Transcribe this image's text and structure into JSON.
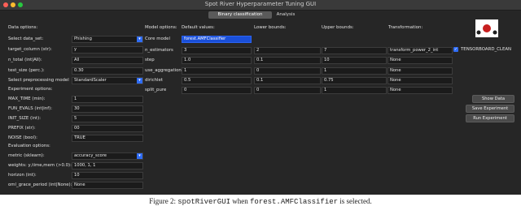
{
  "window": {
    "title": "Spot River Hyperparameter Tuning GUI"
  },
  "tabs": [
    {
      "label": "Binary classification"
    },
    {
      "label": "Analysis"
    }
  ],
  "data": {
    "header": "Data options:",
    "select_data_set_label": "Select data_set:",
    "data_set_value": "Phishing",
    "target_column_label": "target_column (str):",
    "target_column_value": "y",
    "n_total_label": "n_total (int|All):",
    "n_total_value": "All",
    "test_size_label": "test_size (perc.):",
    "test_size_value": "0.30",
    "prep_model_label": "Select preprocessing model",
    "prep_model_value": "StandardScaler"
  },
  "experiment": {
    "header": "Experiment options:",
    "max_time_label": "MAX_TIME (min):",
    "max_time_value": "1",
    "fun_evals_label": "FUN_EVALS (int|inf):",
    "fun_evals_value": "30",
    "init_size_label": "INIT_SIZE (int):",
    "init_size_value": "5",
    "prefix_label": "PREFIX (str):",
    "prefix_value": "00",
    "noise_label": "NOISE (bool):",
    "noise_value": "TRUE"
  },
  "evaluation": {
    "header": "Evaluation options:",
    "metric_label": "metric (sklearn):",
    "metric_value": "accuracy_score",
    "weights_label": "weights: y,time,mem (>0.0):",
    "weights_value": "1000, 1, 1",
    "horizon_label": "horizon (int):",
    "horizon_value": "10",
    "oml_label": "oml_grace_period (int|None):",
    "oml_value": "None"
  },
  "model": {
    "header": "Model options:",
    "core_model_label": "Core model",
    "core_model_value": "forest.AMFClassifier",
    "col_default": "Default values:",
    "col_lower": "Lower bounds:",
    "col_upper": "Upper bounds:",
    "col_transform": "Transformation:",
    "rows": [
      {
        "name": "n_estimators",
        "default": "3",
        "lower": "2",
        "upper": "7",
        "transform": "transform_power_2_int"
      },
      {
        "name": "step",
        "default": "1.0",
        "lower": "0.1",
        "upper": "10",
        "transform": "None"
      },
      {
        "name": "use_aggregation",
        "default": "1",
        "lower": "0",
        "upper": "1",
        "transform": "None"
      },
      {
        "name": "dirichlet",
        "default": "0.5",
        "lower": "0.1",
        "upper": "0.75",
        "transform": "None"
      },
      {
        "name": "split_pure",
        "default": "0",
        "lower": "0",
        "upper": "1",
        "transform": "None"
      }
    ]
  },
  "tensorboard": {
    "label": "TENSORBOARD_CLEAN",
    "checked": true
  },
  "buttons": {
    "show_data": "Show Data",
    "save_experiment": "Save Experiment",
    "run_experiment": "Run Experiment"
  },
  "caption": {
    "prefix": "Figure 2: ",
    "code1": "spotRiverGUI",
    "middle": " when ",
    "code2": "forest.AMFClassifier",
    "suffix": " is selected."
  }
}
